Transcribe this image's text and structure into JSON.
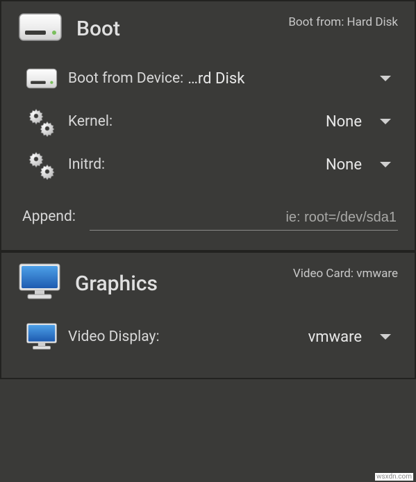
{
  "boot": {
    "title": "Boot",
    "subtitle": "Boot from: Hard Disk",
    "device_label": "Boot from Device:",
    "device_value": "…rd Disk",
    "kernel_label": "Kernel:",
    "kernel_value": "None",
    "initrd_label": "Initrd:",
    "initrd_value": "None",
    "append_label": "Append:",
    "append_placeholder": "ie: root=/dev/sda1"
  },
  "graphics": {
    "title": "Graphics",
    "subtitle": "Video Card: vmware",
    "display_label": "Video Display:",
    "display_value": "vmware"
  },
  "watermark": "wsxdn.com"
}
